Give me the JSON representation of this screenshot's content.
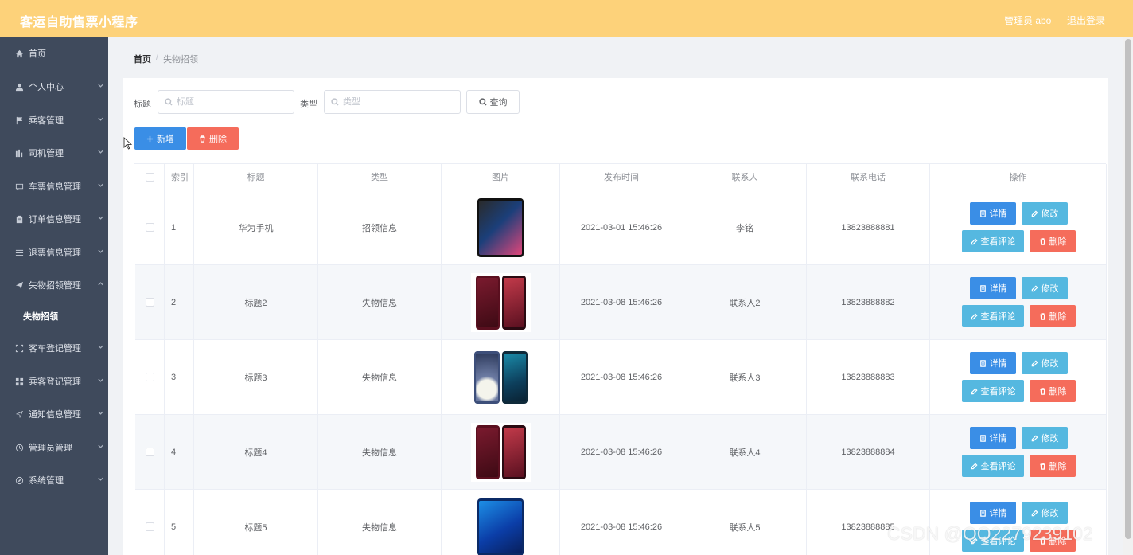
{
  "header": {
    "app_title": "客运自助售票小程序",
    "user_label": "管理员 abo",
    "logout_label": "退出登录",
    "bg_color": "#fdd27a"
  },
  "sidebar": {
    "bg_color": "#3f4a5c",
    "items": [
      {
        "label": "首页",
        "icon": "home-icon",
        "expandable": false
      },
      {
        "label": "个人中心",
        "icon": "user-icon",
        "expandable": true
      },
      {
        "label": "乘客管理",
        "icon": "flag-icon",
        "expandable": true
      },
      {
        "label": "司机管理",
        "icon": "bar-chart-icon",
        "expandable": true
      },
      {
        "label": "车票信息管理",
        "icon": "chat-icon",
        "expandable": true
      },
      {
        "label": "订单信息管理",
        "icon": "clipboard-icon",
        "expandable": true
      },
      {
        "label": "退票信息管理",
        "icon": "list-icon",
        "expandable": true
      },
      {
        "label": "失物招领管理",
        "icon": "send-icon",
        "expandable": true,
        "expanded": true,
        "children": [
          "失物招领"
        ]
      },
      {
        "label": "客车登记管理",
        "icon": "fullscreen-icon",
        "expandable": true
      },
      {
        "label": "乘客登记管理",
        "icon": "grid-icon",
        "expandable": true
      },
      {
        "label": "通知信息管理",
        "icon": "navigation-icon",
        "expandable": true
      },
      {
        "label": "管理员管理",
        "icon": "clock-icon",
        "expandable": true
      },
      {
        "label": "系统管理",
        "icon": "compass-icon",
        "expandable": true
      }
    ]
  },
  "breadcrumb": {
    "home": "首页",
    "separator": "/",
    "current": "失物招领"
  },
  "search": {
    "title_label": "标题",
    "title_placeholder": "标题",
    "type_label": "类型",
    "type_placeholder": "类型",
    "query_button": "查询"
  },
  "actions": {
    "add_button": "新增",
    "delete_button": "删除"
  },
  "table": {
    "columns": [
      "索引",
      "标题",
      "类型",
      "图片",
      "发布时间",
      "联系人",
      "联系电话",
      "操作"
    ],
    "row_actions": {
      "detail": "详情",
      "edit": "修改",
      "comments": "查看评论",
      "delete": "删除"
    },
    "rows": [
      {
        "index": "1",
        "title": "华为手机",
        "type": "招领信息",
        "image": "black-phone",
        "time": "2021-03-01 15:46:26",
        "contact": "李铭",
        "phone": "13823888881"
      },
      {
        "index": "2",
        "title": "标题2",
        "type": "失物信息",
        "image": "red-phone",
        "time": "2021-03-08 15:46:26",
        "contact": "联系人2",
        "phone": "13823888882"
      },
      {
        "index": "3",
        "title": "标题3",
        "type": "失物信息",
        "image": "floral-phones",
        "time": "2021-03-08 15:46:26",
        "contact": "联系人3",
        "phone": "13823888883"
      },
      {
        "index": "4",
        "title": "标题4",
        "type": "失物信息",
        "image": "red-phone",
        "time": "2021-03-08 15:46:26",
        "contact": "联系人4",
        "phone": "13823888884"
      },
      {
        "index": "5",
        "title": "标题5",
        "type": "失物信息",
        "image": "blue-phone",
        "time": "2021-03-08 15:46:26",
        "contact": "联系人5",
        "phone": "13823888885"
      }
    ]
  },
  "colors": {
    "primary_blue": "#3a8ee6",
    "danger_red": "#f56c5b",
    "sky_blue": "#55b8e0"
  },
  "watermark": "CSDN @QQ2279239102"
}
